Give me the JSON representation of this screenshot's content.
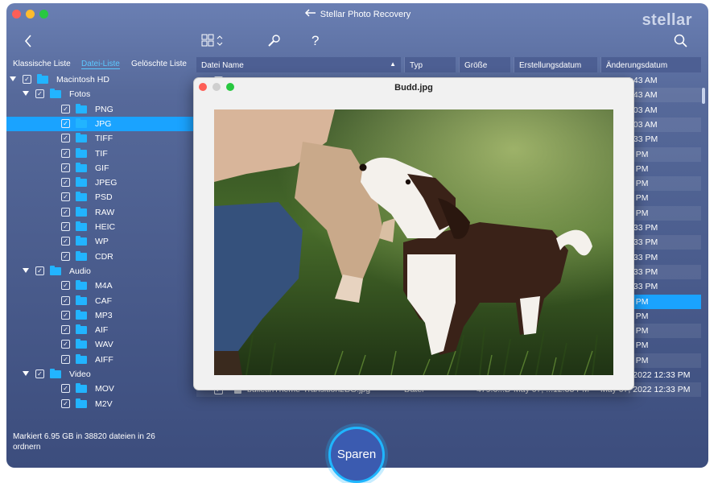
{
  "app": {
    "title": "Stellar Photo Recovery",
    "brand": "stellar"
  },
  "toolbar": {
    "back_icon": "chevron-left-icon",
    "view_icon": "grid-view-icon",
    "tools_icon": "wrench-icon",
    "help_icon": "help-icon",
    "search_icon": "search-icon"
  },
  "tabs": [
    {
      "label": "Klassische Liste"
    },
    {
      "label": "Datei-Liste"
    },
    {
      "label": "Gelöschte Liste"
    }
  ],
  "tree": [
    {
      "label": "Macintosh HD",
      "level": 0,
      "expanded": true
    },
    {
      "label": "Fotos",
      "level": 1,
      "expanded": true
    },
    {
      "label": "PNG",
      "level": 2
    },
    {
      "label": "JPG",
      "level": 2,
      "selected": true
    },
    {
      "label": "TIFF",
      "level": 2
    },
    {
      "label": "TIF",
      "level": 2
    },
    {
      "label": "GIF",
      "level": 2
    },
    {
      "label": "JPEG",
      "level": 2
    },
    {
      "label": "PSD",
      "level": 2
    },
    {
      "label": "RAW",
      "level": 2
    },
    {
      "label": "HEIC",
      "level": 2
    },
    {
      "label": "WP",
      "level": 2
    },
    {
      "label": "CDR",
      "level": 2
    },
    {
      "label": "Audio",
      "level": 1,
      "expanded": true
    },
    {
      "label": "M4A",
      "level": 2
    },
    {
      "label": "CAF",
      "level": 2
    },
    {
      "label": "MP3",
      "level": 2
    },
    {
      "label": "AIF",
      "level": 2
    },
    {
      "label": "WAV",
      "level": 2
    },
    {
      "label": "AIFF",
      "level": 2
    },
    {
      "label": "Video",
      "level": 1,
      "expanded": true
    },
    {
      "label": "MOV",
      "level": 2
    },
    {
      "label": "M2V",
      "level": 2
    }
  ],
  "table": {
    "headers": [
      "Datei Name",
      "Typ",
      "Größe",
      "Erstellungsdatum",
      "Änderungsdatum"
    ],
    "rows": [
      {
        "name": "",
        "type": "",
        "size": "",
        "created": "",
        "modified": "2022 04:43 AM"
      },
      {
        "name": "",
        "type": "",
        "size": "",
        "created": "",
        "modified": "2022 04:43 AM"
      },
      {
        "name": "",
        "type": "",
        "size": "",
        "created": "",
        "modified": "2022 06:03 AM"
      },
      {
        "name": "",
        "type": "",
        "size": "",
        "created": "",
        "modified": "2022 06:03 AM"
      },
      {
        "name": "",
        "type": "",
        "size": "",
        "created": "",
        "modified": "2022 12:33 PM"
      },
      {
        "name": "",
        "type": "",
        "size": "",
        "created": "",
        "modified": "21 01:55 PM"
      },
      {
        "name": "",
        "type": "",
        "size": "",
        "created": "",
        "modified": "21 01:55 PM"
      },
      {
        "name": "",
        "type": "",
        "size": "",
        "created": "",
        "modified": "21 01:55 PM"
      },
      {
        "name": "",
        "type": "",
        "size": "",
        "created": "",
        "modified": "21 01:55 PM"
      },
      {
        "name": "",
        "type": "",
        "size": "",
        "created": "",
        "modified": "21 01:55 PM"
      },
      {
        "name": "",
        "type": "",
        "size": "",
        "created": "",
        "modified": "2022 12:33 PM"
      },
      {
        "name": "",
        "type": "",
        "size": "",
        "created": "",
        "modified": "2022 12:33 PM"
      },
      {
        "name": "",
        "type": "",
        "size": "",
        "created": "",
        "modified": "2022 12:33 PM"
      },
      {
        "name": "",
        "type": "",
        "size": "",
        "created": "",
        "modified": "2022 12:33 PM"
      },
      {
        "name": "",
        "type": "",
        "size": "",
        "created": "",
        "modified": "2022 12:33 PM"
      },
      {
        "name": "",
        "type": "",
        "size": "",
        "created": "",
        "modified": "21 02:49 PM",
        "selected": true
      },
      {
        "name": "",
        "type": "",
        "size": "",
        "created": "",
        "modified": "21 02:49 PM"
      },
      {
        "name": "",
        "type": "",
        "size": "",
        "created": "",
        "modified": "21 01:56 PM"
      },
      {
        "name": "",
        "type": "",
        "size": "",
        "created": "",
        "modified": "21 01:56 PM"
      },
      {
        "name": "",
        "type": "",
        "size": "",
        "created": "",
        "modified": "21 01:56 PM"
      },
      {
        "name": "BulletinTheme-Credits1_BG.jpg",
        "type": "Datei",
        "size": "1.05 MB",
        "created": "May 07, ...12:33 PM",
        "modified": "May 07, 2022 12:33 PM"
      },
      {
        "name": "bulletinTheme-Transition2BG.jpg",
        "type": "Datei",
        "size": "479.6...B",
        "created": "May 07, ...12:33 PM",
        "modified": "May 07, 2022 12:33 PM"
      }
    ]
  },
  "status": {
    "text": "Markiert 6.95 GB in 38820 dateien in 26 ordnern"
  },
  "save_button": {
    "label": "Sparen"
  },
  "preview": {
    "title": "Budd.jpg"
  }
}
